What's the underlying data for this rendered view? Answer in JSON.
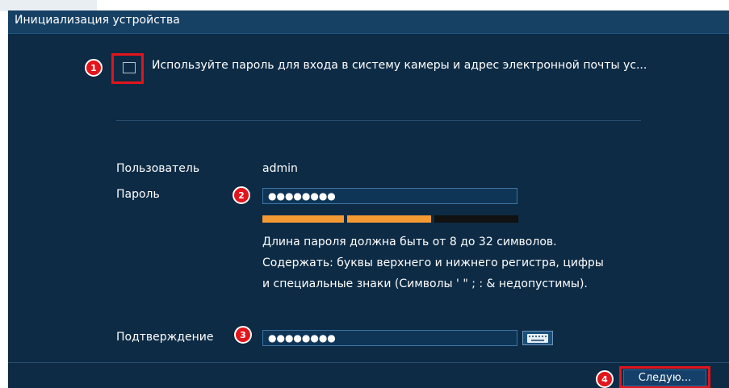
{
  "window": {
    "title": "Инициализация устройства"
  },
  "sync_option": {
    "checked": false,
    "label": "Используйте пароль для входа в систему камеры и адрес электронной почты ус..."
  },
  "user": {
    "label": "Пользователь",
    "value": "admin"
  },
  "password": {
    "label": "Пароль",
    "value": "●●●●●●●●",
    "strength": {
      "segments_filled": 2,
      "segments_total": 3,
      "filled_color": "#f39a33",
      "empty_color": "#111111"
    },
    "hints": [
      "Длина пароля должна быть от 8 до 32 символов.",
      "Содержать: буквы верхнего и нижнего регистра, цифры",
      "и специальные знаки (Символы ' \" ; : & недопустимы)."
    ]
  },
  "confirm": {
    "label": "Подтверждение",
    "value": "●●●●●●●●",
    "keyboard_icon": "keyboard-icon"
  },
  "footer": {
    "next_label": "Следую..."
  },
  "markers": [
    "1",
    "2",
    "3",
    "4"
  ],
  "colors": {
    "background": "#0d2b45",
    "titlebar": "#164064",
    "marker": "#e3141b",
    "input_border": "#3d74a3"
  }
}
